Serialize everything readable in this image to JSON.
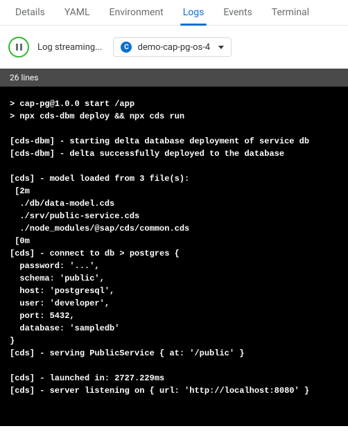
{
  "tabs": {
    "items": [
      {
        "label": "Details",
        "active": false
      },
      {
        "label": "YAML",
        "active": false
      },
      {
        "label": "Environment",
        "active": false
      },
      {
        "label": "Logs",
        "active": true
      },
      {
        "label": "Events",
        "active": false
      },
      {
        "label": "Terminal",
        "active": false
      }
    ]
  },
  "controls": {
    "stream_label": "Log streaming...",
    "dropdown_badge": "C",
    "dropdown_value": "demo-cap-pg-os-4"
  },
  "lines_bar": "26 lines",
  "log": {
    "l0": "> cap-pg@1.0.0 start /app",
    "l1": "> npx cds-dbm deploy && npx cds run",
    "l2": "",
    "l3": "[cds-dbm] - starting delta database deployment of service db",
    "l4": "[cds-dbm] - delta successfully deployed to the database",
    "l5": "",
    "l6": "[cds] - model loaded from 3 file(s):",
    "l7": " [2m",
    "l8": "  ./db/data-model.cds",
    "l9": "  ./srv/public-service.cds",
    "l10": "  ./node_modules/@sap/cds/common.cds",
    "l11": " [0m",
    "l12": "[cds] - connect to db > postgres {",
    "l13": "  password: '...',",
    "l14": "  schema: 'public',",
    "l15": "  host: 'postgresql',",
    "l16": "  user: 'developer',",
    "l17": "  port: 5432,",
    "l18": "  database: 'sampledb'",
    "l19": "}",
    "l20": "[cds] - serving PublicService { at: '/public' }",
    "l21": "",
    "l22": "[cds] - launched in: 2727.229ms",
    "l23": "[cds] - server listening on { url: 'http://localhost:8080' }"
  }
}
